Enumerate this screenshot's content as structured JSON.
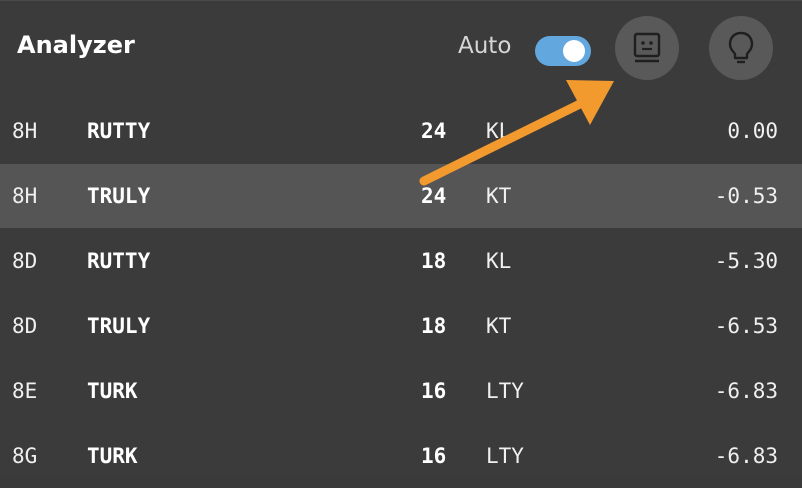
{
  "header": {
    "title": "Analyzer",
    "auto_label": "Auto",
    "auto_enabled": true
  },
  "icons": {
    "robot_button": "robot-face-icon",
    "hint_button": "lightbulb-icon"
  },
  "colors": {
    "toggle_on": "#63a7df",
    "annotation_arrow": "#f29a2e",
    "selected_row": "#555555"
  },
  "moves": [
    {
      "position": "8H",
      "word": "RUTTY",
      "score": "24",
      "leave": "KL",
      "equity": "0.00"
    },
    {
      "position": "8H",
      "word": "TRULY",
      "score": "24",
      "leave": "KT",
      "equity": "-0.53"
    },
    {
      "position": "8D",
      "word": "RUTTY",
      "score": "18",
      "leave": "KL",
      "equity": "-5.30"
    },
    {
      "position": "8D",
      "word": "TRULY",
      "score": "18",
      "leave": "KT",
      "equity": "-6.53"
    },
    {
      "position": "8E",
      "word": "TURK",
      "score": "16",
      "leave": "LTY",
      "equity": "-6.83"
    },
    {
      "position": "8G",
      "word": "TURK",
      "score": "16",
      "leave": "LTY",
      "equity": "-6.83"
    }
  ],
  "selected_index": 1
}
